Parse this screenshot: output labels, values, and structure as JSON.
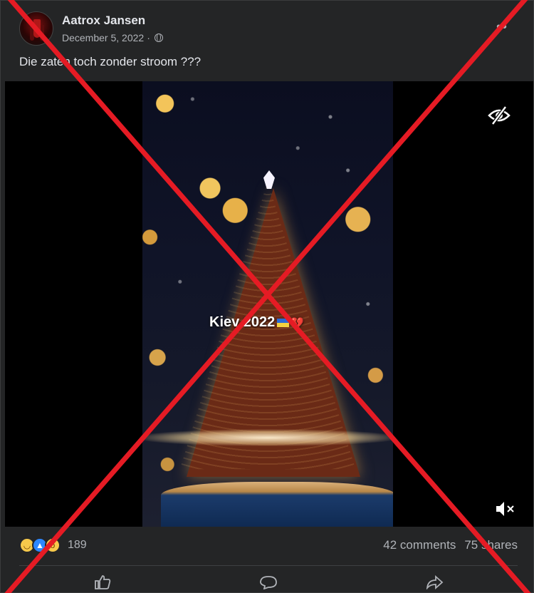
{
  "post": {
    "author": "Aatrox Jansen",
    "date": "December 5, 2022",
    "separator": "·",
    "more_label": "••",
    "caption": "Die zaten toch zonder stroom ???"
  },
  "video": {
    "overlay_text": "Kiev 2022",
    "heart_glyph": "💔"
  },
  "reactions": {
    "types": [
      "haha",
      "like",
      "wow"
    ],
    "count": "189"
  },
  "engagement": {
    "comments": "42 comments",
    "shares": "75 shares"
  },
  "icons": {
    "privacy": "globe-icon",
    "hide": "eye-slash-icon",
    "mute": "speaker-muted-icon",
    "more": "more-options-icon"
  },
  "colors": {
    "card_bg": "#242526",
    "text_primary": "#e4e6eb",
    "text_secondary": "#b0b3b8",
    "cross_red": "#e51b24"
  }
}
